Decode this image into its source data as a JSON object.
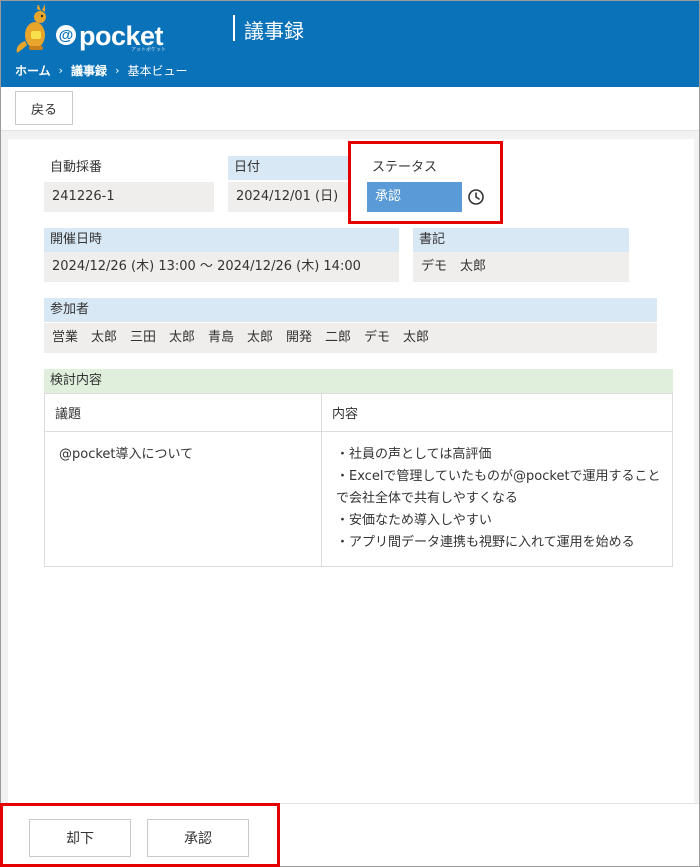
{
  "header": {
    "logo_text": "@pocket",
    "logo_sub": "アットポケット",
    "title": "議事録",
    "breadcrumb": [
      "ホーム",
      "議事録",
      "基本ビュー"
    ]
  },
  "toolbar": {
    "back_label": "戻る"
  },
  "fields": {
    "auto_number": {
      "label": "自動採番",
      "value": "241226-1"
    },
    "date": {
      "label": "日付",
      "value": "2024/12/01 (日)"
    },
    "status": {
      "label": "ステータス",
      "value": "承認"
    },
    "meeting_datetime": {
      "label": "開催日時",
      "value": "2024/12/26 (木) 13:00 ～ 2024/12/26 (木) 14:00"
    },
    "secretary": {
      "label": "書記",
      "value": "デモ　太郎"
    },
    "participants": {
      "label": "参加者",
      "value": "営業　太郎　三田　太郎　青島　太郎　開発　二郎　デモ　太郎"
    }
  },
  "review": {
    "label": "検討内容",
    "columns": [
      "議題",
      "内容"
    ],
    "rows": [
      {
        "topic": "@pocket導入について",
        "content": [
          "・社員の声としては高評価",
          "・Excelで管理していたものが@pocketで運用すること",
          "で会社全体で共有しやすくなる",
          "・安価なため導入しやすい",
          "・アプリ間データ連携も視野に入れて運用を始める"
        ]
      }
    ]
  },
  "footer": {
    "reject_label": "却下",
    "approve_label": "承認"
  },
  "colors": {
    "header": "#0a72b9",
    "status": "#5a9ad6",
    "highlight": "#e50000"
  }
}
